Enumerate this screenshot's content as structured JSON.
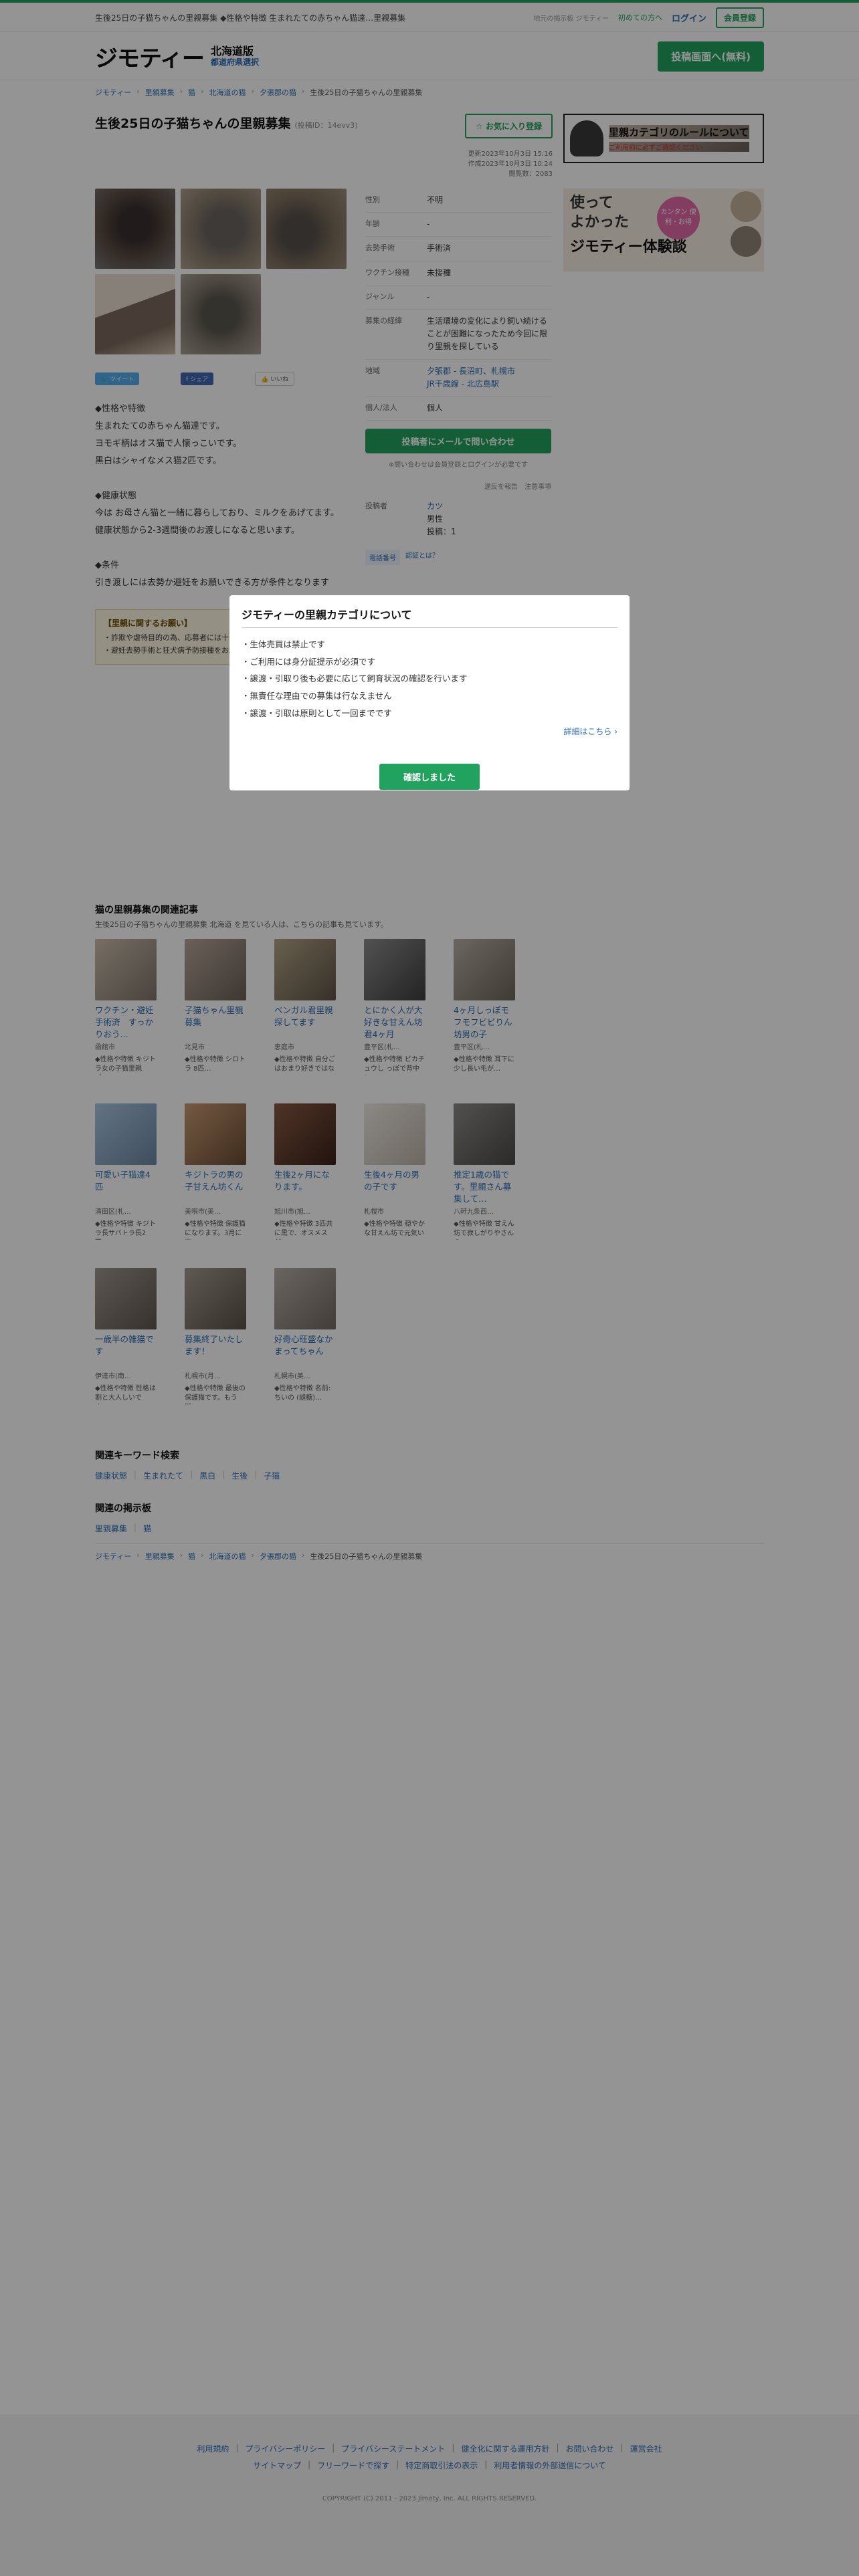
{
  "topbar": {
    "text": "生後25日の子猫ちゃんの里親募集 ◆性格や特徴 生まれたての赤ちゃん猫達…里親募集",
    "muted": "地元の掲示板 ジモティー",
    "beginner": "初めての方へ",
    "login": "ログイン",
    "register": "会員登録"
  },
  "header": {
    "logo": "ジモティー",
    "region": "北海道版",
    "region_select": "都道府県選択",
    "post_button": "投稿画面へ(無料)"
  },
  "breadcrumb": [
    "ジモティー",
    "里親募集",
    "猫",
    "北海道の猫",
    "夕張郡の猫",
    "生後25日の子猫ちゃんの里親募集"
  ],
  "post": {
    "title": "生後25日の子猫ちゃんの里親募集",
    "post_id": "(投稿ID：14evv3)",
    "fav_button": "お気に入り登録",
    "updated": "更新2023年10月3日 15:16",
    "created": "作成2023年10月3日 10:24",
    "views": "閲覧数：2083",
    "social": {
      "tweet": "ツイート",
      "share": "シェア",
      "iine": "いいね"
    },
    "description": "◆性格や特徴\n生まれたての赤ちゃん猫達です。\nヨモギ柄はオス猫で人懐っこいです。\n黒白はシャイなメス猫2匹です。\n\n◆健康状態\n今は お母さん猫と一緒に暮らしており、ミルクをあげてます。\n健康状態から2-3週間後のお渡しになると思います。\n\n◆条件\n引き渡しには去勢か避妊をお願いできる方が条件となります",
    "attributes": [
      {
        "key": "性別",
        "value": "不明"
      },
      {
        "key": "年齢",
        "value": "-"
      },
      {
        "key": "去勢手術",
        "value": "手術済"
      },
      {
        "key": "ワクチン接種",
        "value": "未接種"
      },
      {
        "key": "ジャンル",
        "value": "-"
      },
      {
        "key": "募集の経緯",
        "value": "生活環境の変化により飼い続けることが困難になったため今回に限り里親を探している"
      }
    ],
    "area_key": "地域",
    "area_line1": "夕張郡 - 長沼町、札幌市",
    "area_line2": "JR千歳線 - 北広島駅",
    "type_key": "個人/法人",
    "type_value": "個人",
    "mail_button": "投稿者にメールで問い合わせ",
    "note": "※問い合わせは会員登録とログインが必要です",
    "report": "違反を報告　注意事項",
    "poster_key": "投稿者",
    "poster_name": "カツ",
    "poster_gender": "男性",
    "poster_posts": "投稿：1",
    "badge1": "電話番号",
    "badge2": "認証とは？",
    "notice_title": "【里親に関するお願い】",
    "notice_line1": "・詐欺や虐待目的の為、応募者には十分注意してください",
    "notice_line2": "・避妊去勢手術と狂犬病予防接種をお願いします"
  },
  "side": {
    "banner1_title": "里親カテゴリのルールについて",
    "banner1_sub": "ご利用前に必ずご確認ください",
    "banner2_line1": "使って",
    "banner2_line2": "よかった",
    "banner2_circle": "カンタン 便利・お得",
    "banner2_brand": "ジモティー体験談"
  },
  "related": {
    "title": "猫の里親募集の関連記事",
    "subtitle": "生後25日の子猫ちゃんの里親募集 北海道 を見ている人は、こちらの記事も見ています。",
    "items": [
      {
        "title": "ワクチン・避妊手術済　すっかりおう…",
        "loc": "函館市",
        "snippet": "◆性格や特徴 キジトラ女の子猫里親 ゴ…"
      },
      {
        "title": "子猫ちゃん里親募集",
        "loc": "北見市",
        "snippet": "◆性格や特徴 シロトラ 8匹…"
      },
      {
        "title": "ベンガル君里親探してます",
        "loc": "恵庭市",
        "snippet": "◆性格や特徴 自分ごはおまり好きではない…"
      },
      {
        "title": "とにかく人が大好きな甘えん坊君4ヶ月",
        "loc": "豊平区(札…",
        "snippet": "◆性格や特徴 ビカチュウし っぽで背中に…"
      },
      {
        "title": "4ヶ月しっぽモフモフビビりん坊男の子",
        "loc": "豊平区(札…",
        "snippet": "◆性格や特徴 耳下に少し長い毛が…"
      },
      {
        "title": "可愛い子猫達4匹",
        "loc": "清田区(札…",
        "snippet": "◆性格や特徴 キジトラ長サバトラ長2匹…"
      },
      {
        "title": "キジトラの男の子甘えん坊くん",
        "loc": "美唄市(美…",
        "snippet": "◆性格や特徴 保護猫になります。3月に出…"
      },
      {
        "title": "生後2ヶ月になります。",
        "loc": "旭川市(旭…",
        "snippet": "◆性格や特徴 3匹共に黒で、オスメスが…"
      },
      {
        "title": "生後4ヶ月の男の子です",
        "loc": "札幌市",
        "snippet": "◆性格や特徴 穏やかな甘えん坊で元気いっ…"
      },
      {
        "title": "推定1歳の猫です。里親さん募集して…",
        "loc": "八軒九条西…",
        "snippet": "◆性格や特徴 甘えん坊で寂しがりやさんの…"
      },
      {
        "title": "一歳半の雑猫です",
        "loc": "伊達市(南…",
        "snippet": "◆性格や特徴 性格は割と大人しいです。…"
      },
      {
        "title": "募集終了いたします！",
        "loc": "札幌市(月…",
        "snippet": "◆性格や特徴 最後の保護猫です。もう即…"
      },
      {
        "title": "好奇心旺盛なかまってちゃん",
        "loc": "札幌市(美…",
        "snippet": "◆性格や特徴 名前: ちいの (縫糖)…"
      }
    ]
  },
  "keywords": {
    "title": "関連キーワード検索",
    "items": [
      "健康状態",
      "生まれたて",
      "黒白",
      "生後",
      "子猫"
    ]
  },
  "board": {
    "title": "関連の掲示板",
    "items": [
      "里親募集",
      "猫"
    ]
  },
  "footer": {
    "row1": [
      "利用規約",
      "プライバシーポリシー",
      "プライバシーステートメント",
      "健全化に関する運用方針",
      "お問い合わせ",
      "運営会社"
    ],
    "row2": [
      "サイトマップ",
      "フリーワードで探す",
      "特定商取引法の表示",
      "利用者情報の外部送信について"
    ],
    "copyright": "COPYRIGHT (C) 2011 - 2023 Jimoty, Inc. ALL RIGHTS RESERVED."
  },
  "modal": {
    "title": "ジモティーの里親カテゴリについて",
    "rules": [
      "・生体売買は禁止です",
      "・ご利用には身分証提示が必須です",
      "・譲渡・引取り後も必要に応じて飼育状況の確認を行います",
      "・無責任な理由での募集は行なえません",
      "・譲渡・引取は原則として一回までです"
    ],
    "more": "詳細はこちら ›",
    "ok_button": "確認しました"
  }
}
